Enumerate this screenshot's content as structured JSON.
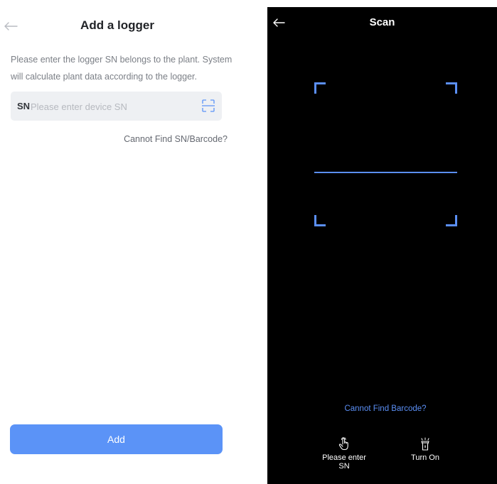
{
  "add_logger_screen": {
    "title": "Add a logger",
    "description": "Please enter the logger SN belongs to the plant. System will calculate plant data according to the logger.",
    "sn_label": "SN",
    "sn_placeholder": "Please enter device SN",
    "sn_value": "",
    "cannot_find_link": "Cannot Find SN/Barcode?",
    "add_button": "Add",
    "accent_color": "#5b93f7"
  },
  "scan_screen": {
    "title": "Scan",
    "cannot_find_link": "Cannot Find Barcode?",
    "manual_entry_label": "Please enter SN",
    "torch_label": "Turn On",
    "frame_color": "#5b8ff5",
    "icons": {
      "back": "arrow-left-icon",
      "manual_entry": "hand-pointer-icon",
      "torch": "flashlight-icon"
    }
  }
}
